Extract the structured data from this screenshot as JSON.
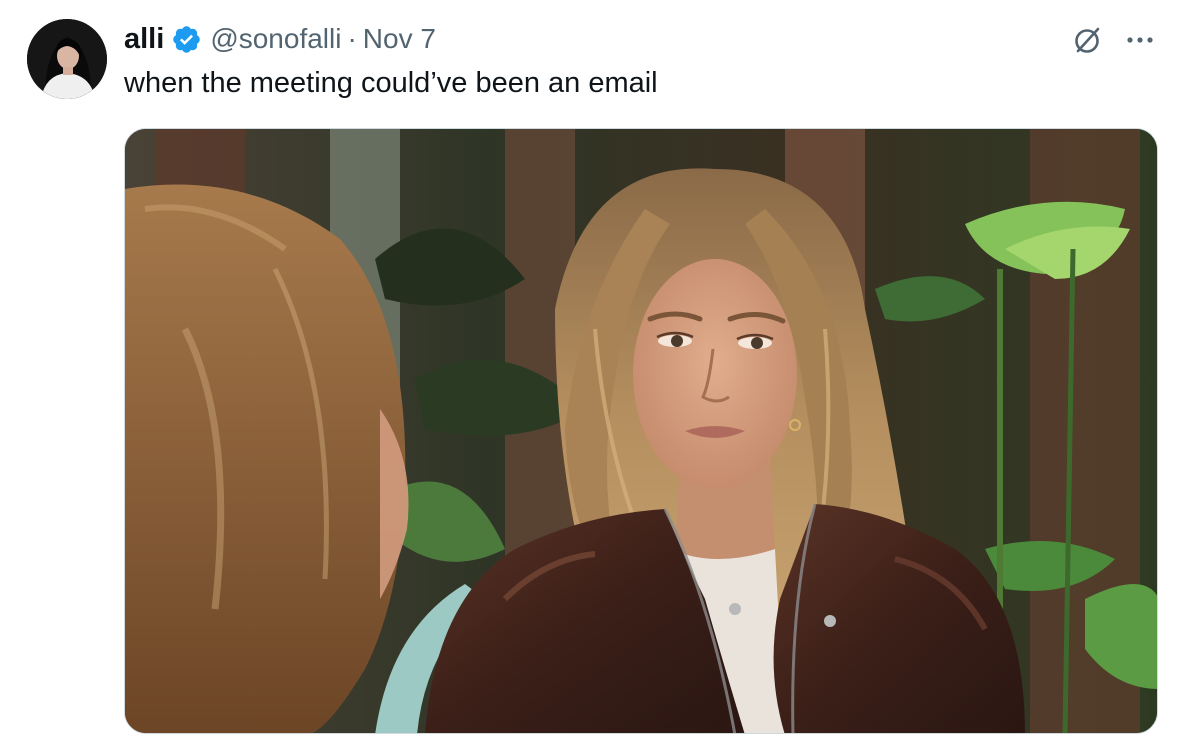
{
  "tweet": {
    "author": {
      "display_name": "alli",
      "handle": "@sonofalli",
      "verified": true,
      "avatar_icon": "profile-photo"
    },
    "separator": "·",
    "date": "Nov 7",
    "text": "when the meeting could’ve been an email",
    "media": {
      "type": "photo",
      "icon": "photo-still"
    },
    "actions": {
      "grok_icon": "grok-icon",
      "more_icon": "more-horizontal-icon"
    }
  },
  "colors": {
    "primary_text": "#0f1419",
    "secondary_text": "#536471",
    "verified_blue": "#1d9bf0",
    "border": "#cfd9de"
  }
}
